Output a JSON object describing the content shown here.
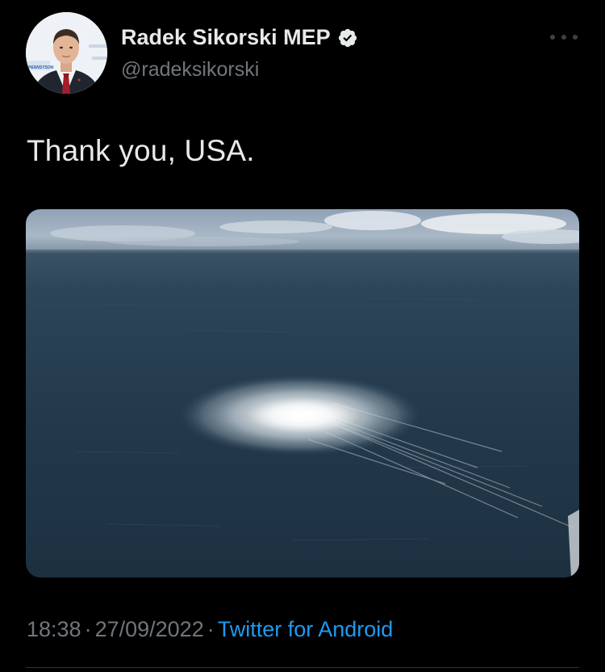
{
  "author": {
    "display_name": "Radek Sikorski MEP",
    "handle": "@radeksikorski",
    "verified": true
  },
  "tweet": {
    "text": "Thank you, USA."
  },
  "meta": {
    "time": "18:38",
    "separator": "·",
    "date": "27/09/2022",
    "source": "Twitter for Android"
  },
  "icons": {
    "verified": "verified-badge-icon",
    "more": "more-options-icon"
  },
  "colors": {
    "background": "#000000",
    "primary_text": "#e7e9ea",
    "secondary_text": "#71767b",
    "link": "#1d9bf0"
  }
}
